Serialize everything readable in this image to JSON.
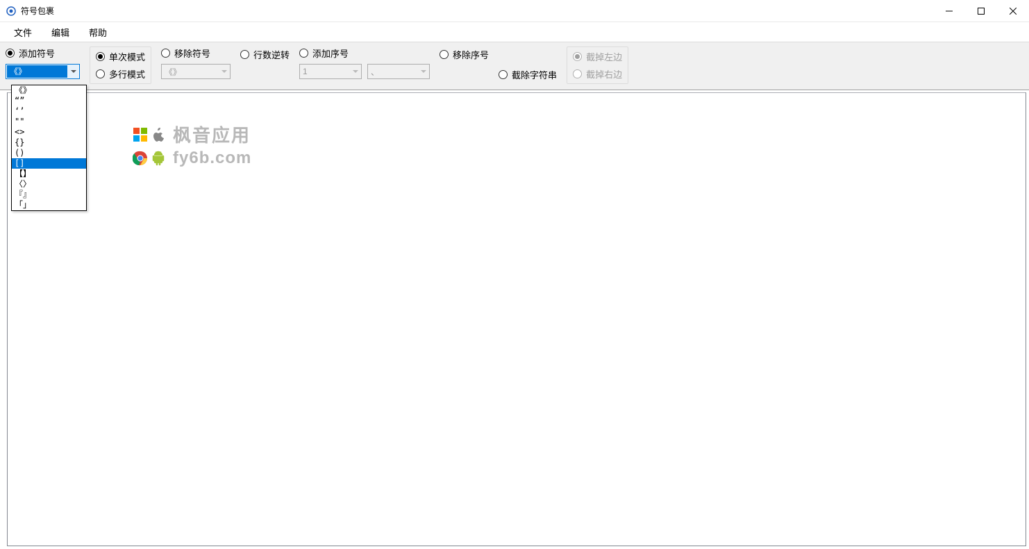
{
  "window": {
    "title": "符号包裹"
  },
  "menu": {
    "file": "文件",
    "edit": "编辑",
    "help": "帮助"
  },
  "toolbar": {
    "add_symbol": "添加符号",
    "single_mode": "单次模式",
    "multi_mode": "多行模式",
    "remove_symbol": "移除符号",
    "reverse_lines": "行数逆转",
    "add_seq": "添加序号",
    "remove_seq": "移除序号",
    "trim_string": "截除字符串",
    "trim_left": "截掉左边",
    "trim_right": "截掉右边"
  },
  "combos": {
    "symbol_selected": "《》",
    "symbol2_selected": "《》",
    "seq_start": "1",
    "seq_sep": "、"
  },
  "dropdown_items": [
    "《》",
    "“”",
    "‘’",
    "\"\"",
    "<>",
    "{}",
    "()",
    "[]",
    "【】",
    "〈〉",
    "『』",
    "「」"
  ],
  "dropdown_highlight_index": 7,
  "watermark": {
    "line1": "枫音应用",
    "line2": "fy6b.com"
  }
}
